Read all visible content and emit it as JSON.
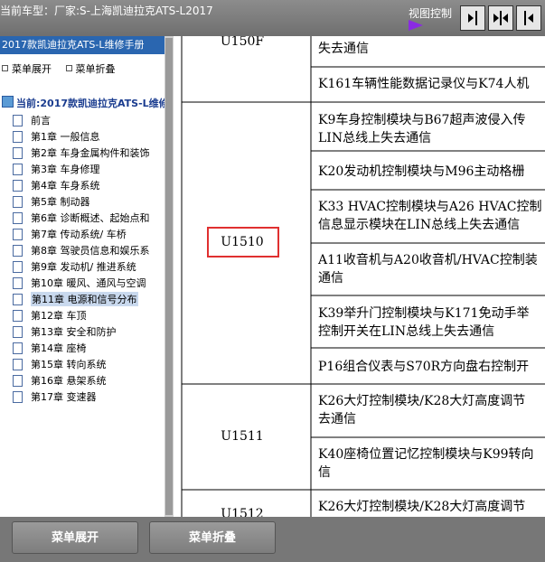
{
  "header": {
    "vehicle_label": "当前车型：厂家:S-上海凯迪拉克ATS-L2017",
    "view_control": "视图控制"
  },
  "sidebar": {
    "manual_title": "2017款凯迪拉克ATS-L维修手册",
    "expand_label": "菜单展开",
    "collapse_label": "菜单折叠",
    "current_label": "当前:2017款凯迪拉克ATS-L维修",
    "items": [
      "前言",
      "第1章 一般信息",
      "第2章 车身金属构件和装饰",
      "第3章 车身修理",
      "第4章 车身系统",
      "第5章 制动器",
      "第6章 诊断概述、起始点和",
      "第7章 传动系统/ 车桥",
      "第8章 驾驶员信息和娱乐系",
      "第9章 发动机/ 推进系统",
      "第10章 暖风、通风与空调",
      "第11章 电源和信号分布",
      "第12章 车顶",
      "第13章 安全和防护",
      "第14章 座椅",
      "第15章 转向系统",
      "第16章 悬架系统",
      "第17章 变速器"
    ],
    "selected_index": 11
  },
  "table": {
    "codes": [
      "U150F",
      "U1510",
      "U1511",
      "U1512"
    ],
    "descriptions": [
      [
        "失去通信"
      ],
      [
        "K161车辆性能数据记录仪与K74人机"
      ],
      [
        "K9车身控制模块与B67超声波侵入传",
        "LIN总线上失去通信"
      ],
      [
        "K20发动机控制模块与M96主动格栅"
      ],
      [
        "K33 HVAC控制模块与A26 HVAC控制",
        "信息显示模块在LIN总线上失去通信"
      ],
      [
        "A11收音机与A20收音机/HVAC控制装",
        "通信"
      ],
      [
        "K39举升门控制模块与K171免动手举",
        "控制开关在LIN总线上失去通信"
      ],
      [
        "P16组合仪表与S70R方向盘右控制开"
      ],
      [
        "K26大灯控制模块/K28大灯高度调节",
        "去通信"
      ],
      [
        "K40座椅位置记忆控制模块与K99转向",
        "信"
      ],
      [
        "K26大灯控制模块/K28大灯高度调节"
      ]
    ]
  },
  "footer": {
    "expand_button": "菜单展开",
    "collapse_button": "菜单折叠"
  }
}
